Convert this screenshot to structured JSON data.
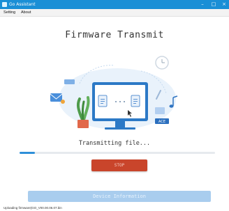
{
  "window": {
    "title": "Go Assistant",
    "minimize": "–",
    "maximize": "□",
    "close": "×"
  },
  "menu": {
    "items": [
      {
        "label": "Setting"
      },
      {
        "label": "About"
      }
    ]
  },
  "main": {
    "title": "Firmware Transmit",
    "status_text": "Transmitting file...",
    "progress": 0.08,
    "stop_label": "STOP",
    "device_info_label": "Device Information"
  },
  "illustration": {
    "badge_text": "ACE"
  },
  "statusbar": {
    "text": "Uploading firmware(GO_V00.00.06.07.bin"
  },
  "colors": {
    "titlebar": "#1a8fd6",
    "accent": "#2e8fd9",
    "stop": "#c9452b",
    "info_button": "#a9cdee"
  }
}
